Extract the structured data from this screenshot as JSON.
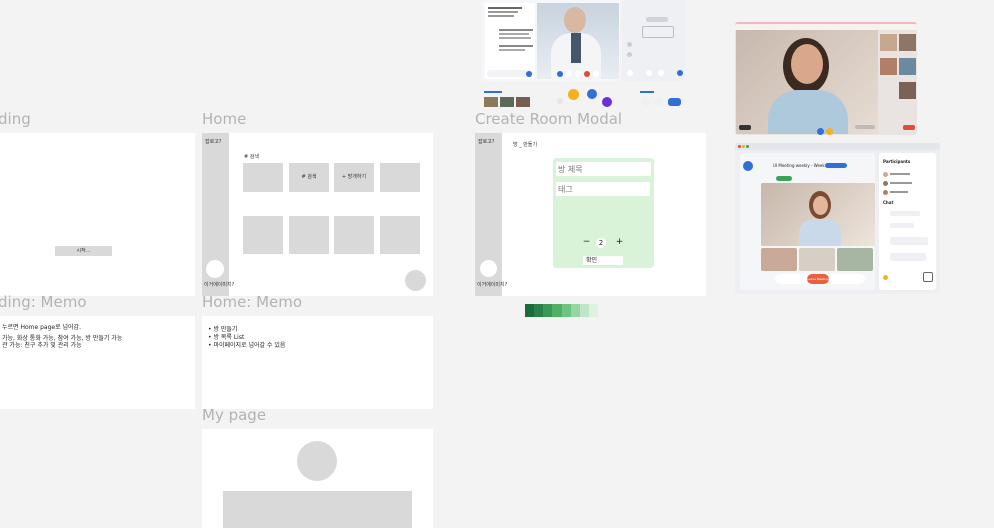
{
  "frames": {
    "landing": {
      "title": "ding",
      "button_label": "시작..."
    },
    "landing_memo": {
      "title": "ding: Memo",
      "lines": [
        "누르면 Home page로 넘어감.",
        "가능, 화상 통화 가능, 참여 가능, 방 만들기 가능",
        "관 가능: 친구 추가 및 관리 가능"
      ]
    },
    "home": {
      "title": "Home",
      "sidebar_top": "잡로고?",
      "sidebar_bottom": "이거에이미지?",
      "section_label": "# 검색",
      "card_search": "# 검색",
      "card_create": "+ 방개하기"
    },
    "home_memo": {
      "title": "Home: Memo",
      "items": [
        "방 만들기",
        "방 목록 List",
        "마이페이지로 넘어갈 수 있음"
      ]
    },
    "create_room": {
      "title": "Create Room Modal",
      "sidebar_top": "잡로고?",
      "sidebar_bottom": "이거에이미지?",
      "header": "방 _ 만들기",
      "room_title_placeholder": "방 제목",
      "tag_placeholder": "태그",
      "count": "2",
      "minus": "−",
      "plus": "+",
      "confirm": "확인"
    },
    "my_page": {
      "title": "My page"
    }
  },
  "palette": {
    "greens": [
      "#1e6b3a",
      "#2a8046",
      "#3a9a55",
      "#4fb066",
      "#6fc482",
      "#95d6a3",
      "#bfe6c7",
      "#dcf3e0"
    ],
    "modal_bg": "#d9f3d9",
    "record_red": "#e04b3a",
    "brand_blue": "#2f6fd6"
  },
  "references": {
    "meeting_ui": {
      "window_title": "UI Meeting weekly - Week 13",
      "participants_heading": "Participants",
      "chat_heading": "Chat",
      "leave_label": "Leave Meeting"
    }
  }
}
